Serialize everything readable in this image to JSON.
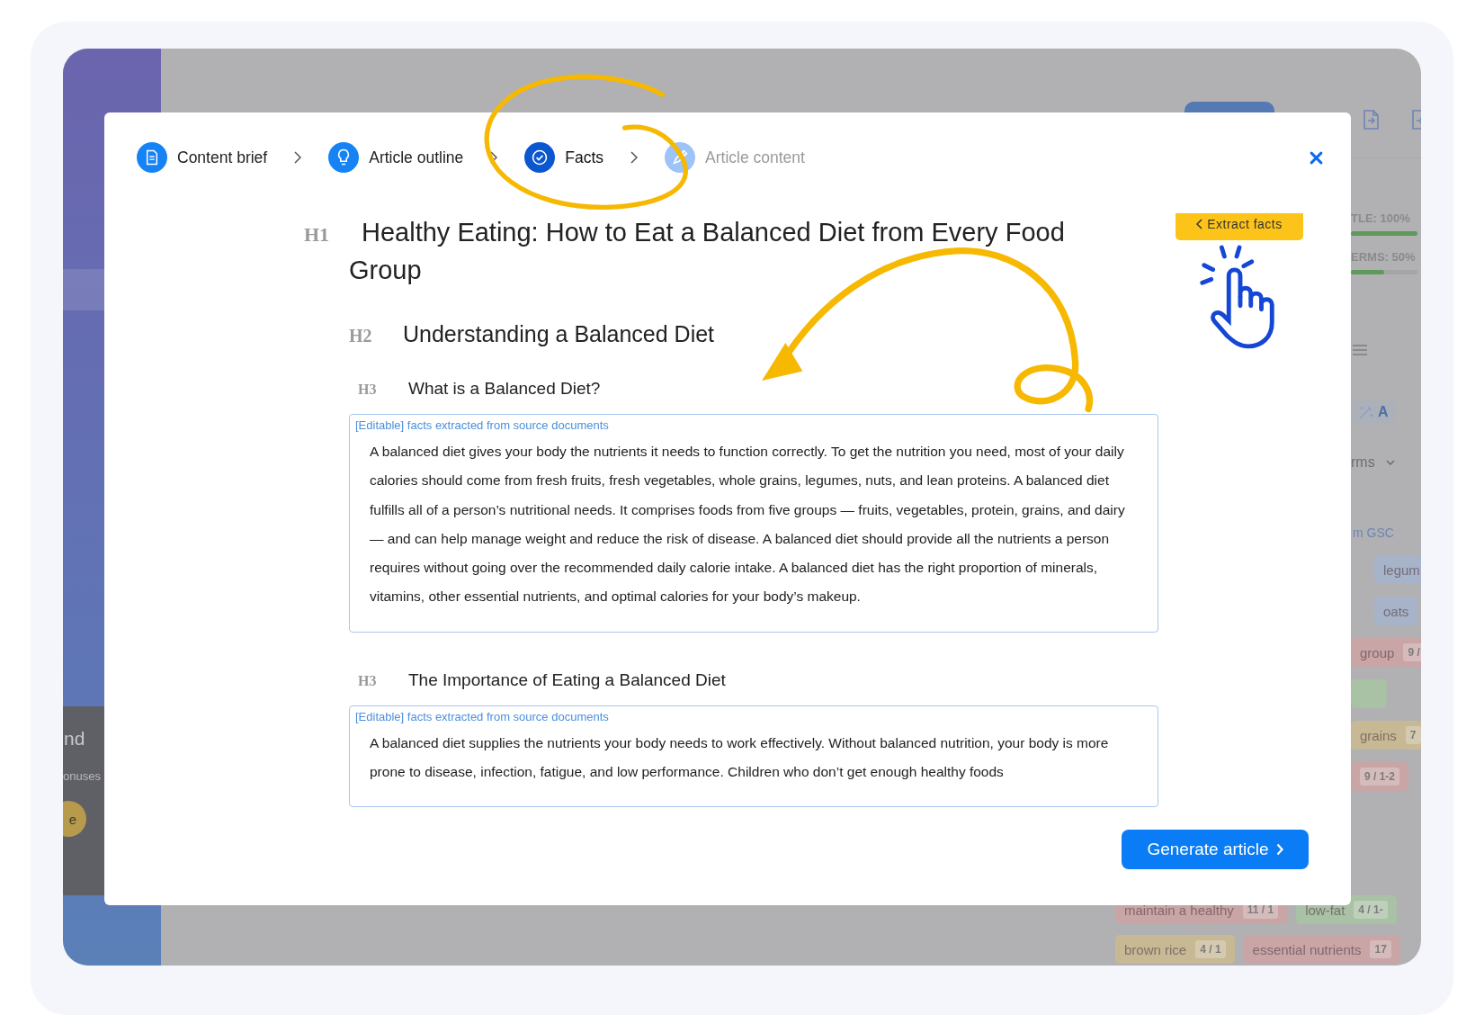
{
  "background": {
    "sidebar": {
      "panel_title": "nd",
      "panel_text": "onuses",
      "badge": "e"
    },
    "side_panel": [
      {
        "kind": "meter",
        "label": "TLE: 100%",
        "level": 1
      },
      {
        "kind": "meter",
        "label": "ERMS: 50%",
        "level": 0.5
      },
      {
        "kind": "list-icon"
      },
      {
        "kind": "tool",
        "label": "A"
      },
      {
        "kind": "dropdown",
        "label": "rms"
      },
      {
        "kind": "link",
        "label": "m GSC"
      },
      {
        "kind": "tag",
        "text": "legum",
        "color": "#a7b3c8"
      },
      {
        "kind": "tag",
        "text": "oats",
        "color": "#a7b3c8"
      },
      {
        "kind": "tag",
        "text": "group",
        "count": "9 /",
        "color": "#c9a5a6"
      },
      {
        "kind": "tag",
        "color": "#a9c1a4"
      },
      {
        "kind": "tag",
        "text": "grains",
        "count": "7",
        "color": "#c7b994"
      },
      {
        "kind": "tag",
        "count": "9 / 1-2",
        "color": "#c9a5a6"
      }
    ],
    "bottom_tags": [
      [
        {
          "text": "maintain a healthy",
          "count": "11 / 1",
          "color": "#c9a5a6"
        },
        {
          "text": "low-fat",
          "count": "4 / 1-",
          "color": "#a9c1a4"
        }
      ],
      [
        {
          "text": "brown rice",
          "count": "4 / 1",
          "color": "#c7b994"
        },
        {
          "text": "essential nutrients",
          "count": "17",
          "color": "#c9a5a6"
        }
      ]
    ]
  },
  "modal": {
    "steps": [
      {
        "label": "Content brief",
        "completed": true,
        "selected": false
      },
      {
        "label": "Article outline",
        "completed": true,
        "selected": false
      },
      {
        "label": "Facts",
        "completed": false,
        "selected": true
      },
      {
        "label": "Article content",
        "completed": false,
        "selected": false
      }
    ],
    "extract_button": "Extract facts",
    "sections": [
      {
        "kind": "h1",
        "tag": "H1",
        "text": "Healthy Eating: How to Eat a Balanced Diet from Every Food Group"
      },
      {
        "kind": "h2",
        "tag": "H2",
        "text": "Understanding a Balanced Diet"
      },
      {
        "kind": "h3",
        "tag": "H3",
        "text": "What is a Balanced Diet?",
        "facts": {
          "label": "[Editable] facts extracted from source documents",
          "text": "A balanced diet gives your body the nutrients it needs to function correctly. To get the nutrition you need, most of your daily calories should come from fresh fruits, fresh vegetables, whole grains, legumes, nuts, and lean proteins. A balanced diet fulfills all of a person’s nutritional needs. It comprises foods from five groups — fruits, vegetables, protein, grains, and dairy — and can help manage weight and reduce the risk of disease. A balanced diet should provide all the nutrients a person requires without going over the recommended daily calorie intake. A balanced diet has the right proportion of minerals, vitamins, other essential nutrients, and optimal calories for your body’s makeup."
        }
      },
      {
        "kind": "h3",
        "tag": "H3",
        "text": "The Importance of Eating a Balanced Diet",
        "facts": {
          "label": "[Editable] facts extracted from source documents",
          "text": "A balanced diet supplies the nutrients your body needs to work effectively. Without balanced nutrition, your body is more prone to disease, infection, fatigue, and low performance. Children who don’t get enough healthy foods"
        }
      }
    ],
    "generate_button": "Generate article"
  }
}
